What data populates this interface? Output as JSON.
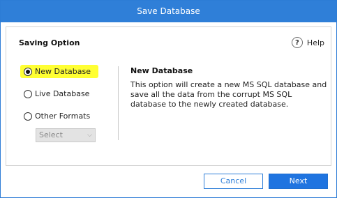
{
  "window": {
    "title": "Save Database"
  },
  "saving_option": {
    "title": "Saving Option",
    "help_icon_text": "?",
    "help_label": "Help",
    "options": [
      {
        "label": "New Database",
        "checked": true
      },
      {
        "label": "Live Database",
        "checked": false
      },
      {
        "label": "Other Formats",
        "checked": false
      }
    ],
    "format_select": {
      "value": "Select",
      "enabled": false
    }
  },
  "description": {
    "title": "New Database",
    "text": "This option will create a new MS SQL database and save all the data from the corrupt MS SQL database to the newly created database."
  },
  "buttons": {
    "cancel": "Cancel",
    "next": "Next"
  },
  "colors": {
    "titlebar": "#2f7fd8",
    "highlight": "#ffff33",
    "primary_button": "#1f74e0"
  }
}
